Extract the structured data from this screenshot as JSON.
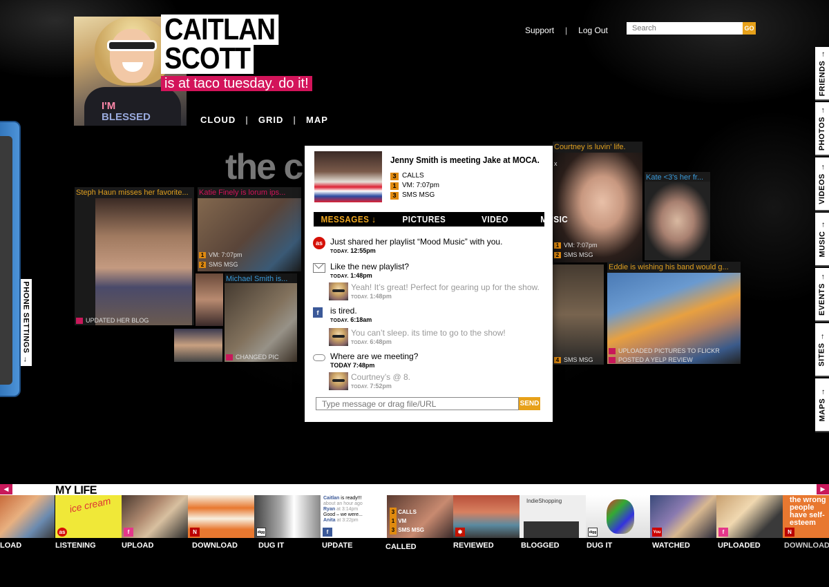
{
  "profile": {
    "first_name": "CAITLAN",
    "last_name": "SCOTT",
    "status": "is at taco tuesday. do it!",
    "shirt_line1": "I'M",
    "shirt_line2": "BLESSED"
  },
  "view_nav": [
    "CLOUD",
    "GRID",
    "MAP"
  ],
  "nav_sep": "|",
  "top_links": {
    "support": "Support",
    "logout": "Log Out",
    "sep": "|"
  },
  "search": {
    "placeholder": "Search",
    "button": "GO"
  },
  "side_tabs": [
    "FRIENDS",
    "PHOTOS",
    "VIDEOS",
    "MUSIC",
    "EVENTS",
    "SITES",
    "MAPS"
  ],
  "side_arrow": "→",
  "phone_settings": "PHONE SETTINGS",
  "phone_settings_arrow": "→",
  "cloud": {
    "title": "the cr",
    "tiles": {
      "steph_caption": "Steph Haun misses her favorite...",
      "steph_tag": "UPDATED HER BLOG",
      "katie_caption": "Katie Finely is lorum ips...",
      "katie_tag1": "VM: 7:07pm",
      "katie_tag2": "SMS MSG",
      "michael_caption": "Michael Smith is...",
      "michael_tag": "CHANGED PIC",
      "courtney_caption": "Courtney is luvin' life.",
      "courtney_tag1": "VM: 7:07pm",
      "courtney_tag2": "SMS MSG",
      "kate_caption": "Kate <3's her fr...",
      "eddie_caption": "Eddie is wishing his band would g...",
      "eddie_tag1": "UPLOADED PICTURES TO FLICKR",
      "eddie_tag2": "POSTED A YELP REVIEW",
      "mid_tag": "SMS MSG",
      "tag_nums": [
        "1",
        "2",
        "4"
      ]
    }
  },
  "popup": {
    "headline": "Jenny Smith is meeting Jake at MOCA.",
    "close": "x",
    "stats": [
      {
        "num": "3",
        "label": "CALLS"
      },
      {
        "num": "1",
        "label": "VM: 7:07pm"
      },
      {
        "num": "3",
        "label": "SMS MSG"
      }
    ],
    "tabs": {
      "messages": "MESSAGES",
      "messages_arrow": "↓",
      "pictures": "PICTURES",
      "video": "VIDEO",
      "music": "MUSIC"
    },
    "feed": {
      "item1_text": "Just shared her playlist “Mood Music” with you.",
      "item1_day": "TODAY.",
      "item1_time": "12:55pm",
      "item2_text": "Like the new playlist?",
      "item2_day": "TODAY.",
      "item2_time": "1:48pm",
      "reply1_text": "Yeah! It’s great! Perfect for gearing up for the show.",
      "reply1_day": "TODAY.",
      "reply1_time": "1:48pm",
      "item3_text": "is tired.",
      "item3_day": "TODAY.",
      "item3_time": "6:18am",
      "reply2_text": "You can’t sleep. its time to go to the show!",
      "reply2_day": "TODAY.",
      "reply2_time": "6:48pm",
      "item4_text": "Where are we meeting?",
      "item4_day": "TODAY",
      "item4_time": "7:48pm",
      "reply3_text": "Courtney’s @ 8.",
      "reply3_day": "TODAY.",
      "reply3_time": "7:52pm"
    },
    "lastfm_icon": "as",
    "fb_icon": "f",
    "input_placeholder": "Type message or drag file/URL",
    "send": "SEND"
  },
  "mylife": {
    "title": "MY LIFE",
    "left_arrow": "◀",
    "right_arrow": "▶",
    "labels": [
      "LOAD",
      "LISTENING",
      "UPLOAD",
      "DOWNLOAD",
      "DUG IT",
      "UPDATE",
      "CALLED",
      "REVIEWED",
      "BLOGGED",
      "DUG IT",
      "WATCHED",
      "UPLOADED",
      "DOWNLOAD"
    ],
    "update_tile": {
      "line1_name": "Caitlan",
      "line1_text": "is ready!!!",
      "line1_time": "about an hour ago",
      "line2_name": "Ryan",
      "line2_time": "at 3:14pm",
      "line2_text": "Good – we were...",
      "line3_name": "Anita",
      "line3_time": "at 3:22pm"
    },
    "called_tile": [
      {
        "num": "3",
        "label": "CALLS"
      },
      {
        "num": "1",
        "label": "VM"
      },
      {
        "num": "3",
        "label": "SMS MSG"
      }
    ],
    "listening_text": "ice cream",
    "blog_tile_title": "IndieShopping",
    "download_tile_text": "the wrong people have self-esteem",
    "badges": {
      "lastfm": "as",
      "facebook": "f",
      "netflix": "N",
      "digg": "digg",
      "youtube": "You"
    }
  },
  "colors": {
    "accent_orange": "#e7a11a",
    "accent_pink": "#d3145a",
    "background": "#000000"
  }
}
